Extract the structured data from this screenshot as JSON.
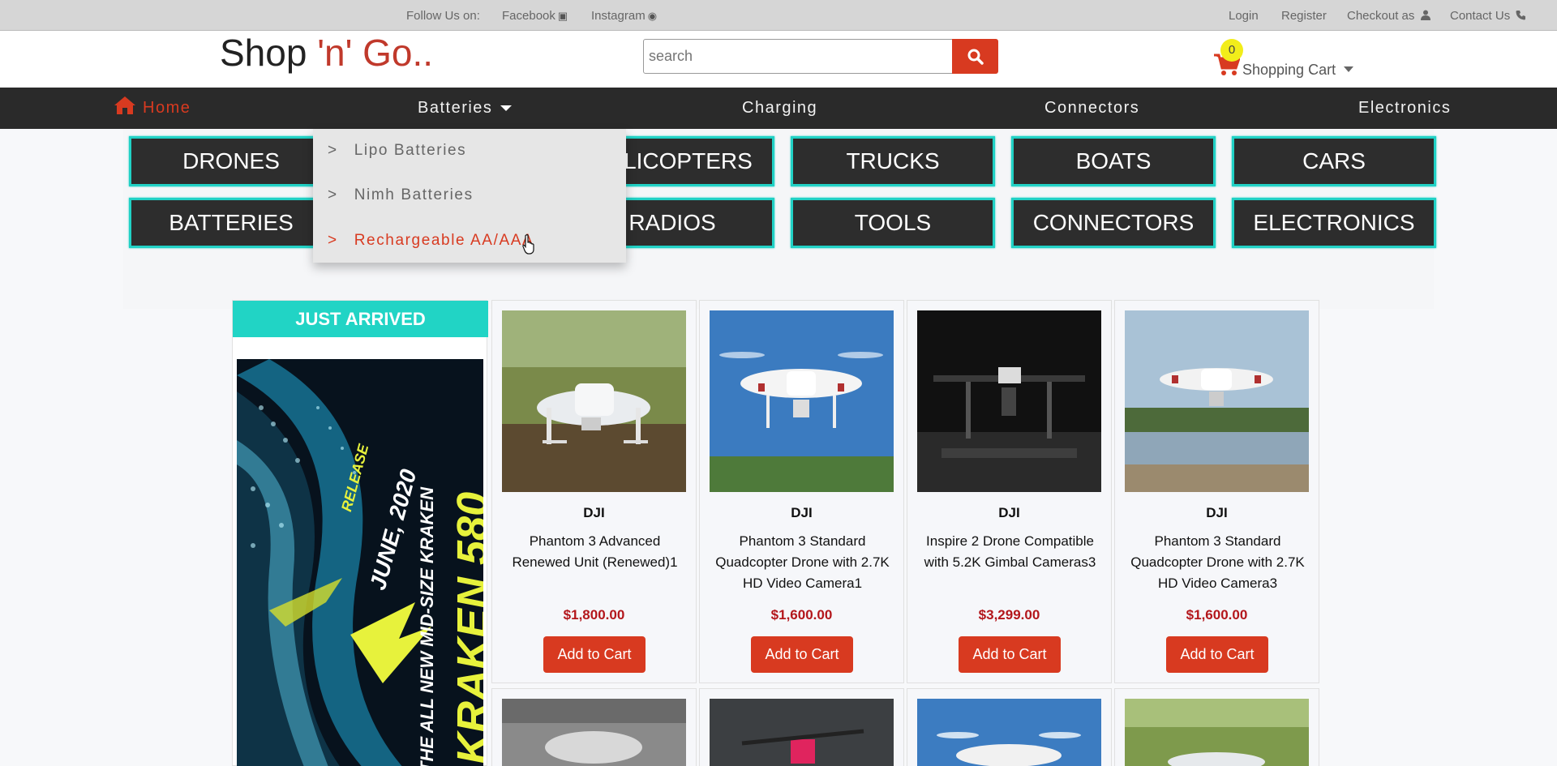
{
  "topbar": {
    "follow_label": "Follow Us on:",
    "facebook": "Facebook",
    "instagram": "Instagram",
    "login": "Login",
    "register": "Register",
    "checkout": "Checkout as",
    "contact": "Contact Us"
  },
  "header": {
    "logo_main": "Shop ",
    "logo_accent": "'n' Go..",
    "search_placeholder": "search",
    "cart_count": "0",
    "cart_label": "Shopping Cart"
  },
  "nav": {
    "home": "Home",
    "batteries": "Batteries",
    "charging": "Charging",
    "connectors": "Connectors",
    "electronics": "Electronics"
  },
  "dropdown": {
    "items": [
      {
        "label": "Lipo Batteries"
      },
      {
        "label": "Nimh Batteries"
      },
      {
        "label": "Rechargeable AA/AAA"
      }
    ],
    "marker": ">"
  },
  "categories": {
    "row1": [
      "DRONES",
      "HELICOPTERS",
      "TRUCKS",
      "BOATS",
      "CARS"
    ],
    "row2": [
      "BATTERIES",
      "RADIOS",
      "TOOLS",
      "CONNECTORS",
      "ELECTRONICS"
    ]
  },
  "promo": {
    "banner": "JUST ARRIVED",
    "poster_title": "KRAKEN 580",
    "poster_sub": "THE ALL NEW MID-SIZE KRAKEN",
    "poster_date": "JUNE, 2020",
    "poster_release": "RELEASE"
  },
  "products": [
    {
      "brand": "DJI",
      "name": "Phantom 3 Advanced Renewed Unit (Renewed)1",
      "price": "$1,800.00",
      "cta": "Add to Cart"
    },
    {
      "brand": "DJI",
      "name": "Phantom 3 Standard Quadcopter Drone with 2.7K HD Video Camera1",
      "price": "$1,600.00",
      "cta": "Add to Cart"
    },
    {
      "brand": "DJI",
      "name": "Inspire 2 Drone Compatible with 5.2K Gimbal Cameras3",
      "price": "$3,299.00",
      "cta": "Add to Cart"
    },
    {
      "brand": "DJI",
      "name": "Phantom 3 Standard Quadcopter Drone with 2.7K HD Video Camera3",
      "price": "$1,600.00",
      "cta": "Add to Cart"
    }
  ],
  "colors": {
    "accent": "#d83a20",
    "teal": "#21d1c5",
    "nav_bg": "#2a2a2a",
    "price": "#b3161b",
    "badge": "#f2ed1a"
  }
}
